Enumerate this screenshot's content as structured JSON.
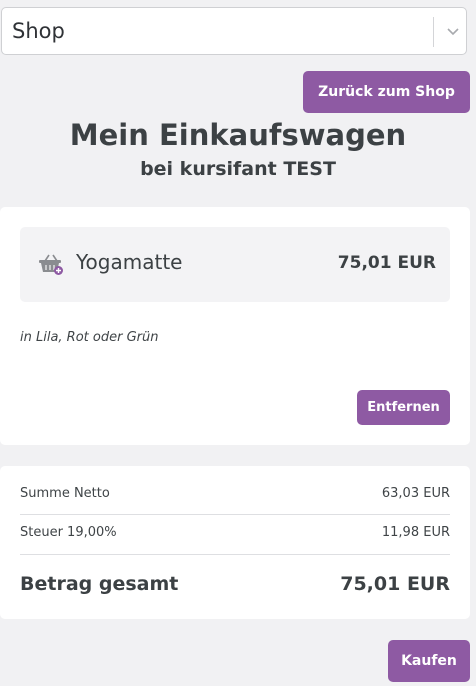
{
  "select": {
    "value": "Shop",
    "icon": "chevron-down-icon"
  },
  "buttons": {
    "back": "Zurück zum Shop",
    "remove": "Entfernen",
    "buy": "Kaufen"
  },
  "header": {
    "title": "Mein Einkaufswagen",
    "subtitle": "bei kursifant TEST"
  },
  "cart": {
    "item": {
      "name": "Yogamatte",
      "price": "75,01 EUR",
      "note": "in Lila, Rot oder Grün",
      "icon": "basket-icon"
    }
  },
  "summary": {
    "netto_label": "Summe Netto",
    "netto_value": "63,03 EUR",
    "tax_label": "Steuer 19,00%",
    "tax_value": "11,98 EUR",
    "total_label": "Betrag gesamt",
    "total_value": "75,01 EUR"
  },
  "colors": {
    "accent": "#8e5aa3",
    "background": "#f1f1f3",
    "card": "#ffffff"
  }
}
